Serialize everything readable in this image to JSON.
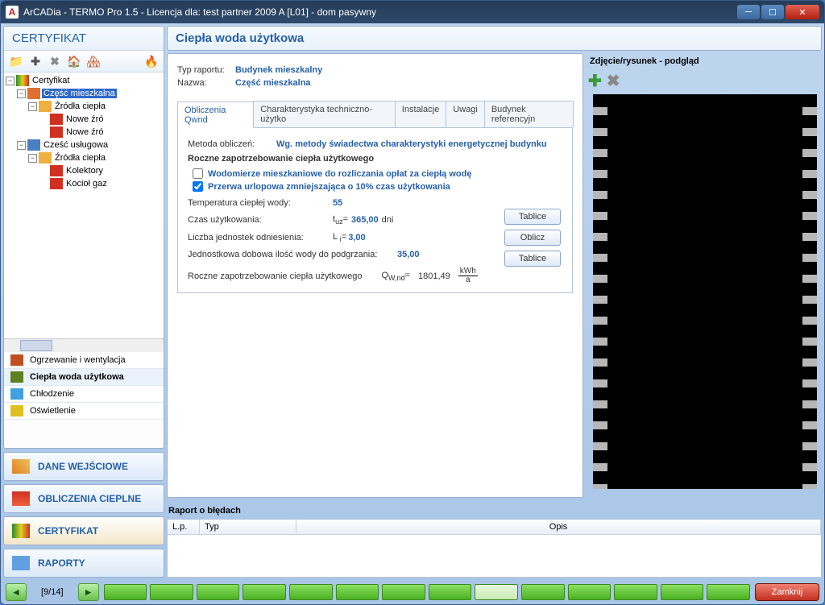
{
  "window": {
    "title": "ArCADia - TERMO Pro 1.5 - Licencja dla: test partner 2009 A [L01] - dom pasywny"
  },
  "left_panel": {
    "title": "CERTYFIKAT",
    "tree": {
      "root": "Certyfikat",
      "n1": "Część mieszkalna",
      "n1a": "Źródła ciepła",
      "n1a1": "Nowe źró",
      "n1a2": "Nowe źró",
      "n2": "Cześć usługowa",
      "n2a": "Źródła ciepła",
      "n2a1": "Kolektory",
      "n2a2": "Kocioł gaz"
    },
    "nav_items": {
      "i1": "Ogrzewanie i wentylacja",
      "i2": "Ciepła woda użytkowa",
      "i3": "Chłodzenie",
      "i4": "Oświetlenie"
    },
    "nav_buttons": {
      "b1": "DANE WEJŚCIOWE",
      "b2": "OBLICZENIA CIEPLNE",
      "b3": "CERTYFIKAT",
      "b4": "RAPORTY"
    }
  },
  "main": {
    "title": "Ciepła woda użytkowa",
    "typ_raportu_label": "Typ raportu:",
    "typ_raportu_value": "Budynek mieszkalny",
    "nazwa_label": "Nazwa:",
    "nazwa_value": "Część mieszkalna",
    "tabs": {
      "t1": "Obliczenia Qwnd",
      "t2": "Charakterystyka techniczno-użytko",
      "t3": "Instalacje",
      "t4": "Uwagi",
      "t5": "Budynek referencyjn"
    },
    "metoda_label": "Metoda obliczeń:",
    "metoda_value": "Wg. metody świadectwa charakterystyki energetycznej budynku",
    "section": "Roczne zapotrzebowanie ciepła użytkowego",
    "chk1": "Wodomierze mieszkaniowe do rozliczania opłat za ciepłą wodę",
    "chk2": "Przerwa urlopowa zmniejszająca o 10% czas użytkowania",
    "temp_label": "Temperatura ciepłej wody:",
    "temp_value": "55",
    "czas_label": "Czas użytkowania:",
    "czas_sym": "t",
    "czas_sub": "uz",
    "czas_value": "365,00",
    "czas_unit": "dni",
    "liczba_label": "Liczba jednostek odniesienia:",
    "liczba_sym": "L",
    "liczba_sub": "i",
    "liczba_value": "3,00",
    "jedn_label": "Jednostkowa dobowa ilość wody do podgrzania:",
    "jedn_value": "35,00",
    "roczne_label": "Roczne zapotrzebowanie ciepła użytkowego",
    "roczne_sym": "Q",
    "roczne_sub": "W,nd",
    "roczne_value": "1801,49",
    "roczne_unit_t": "kWh",
    "roczne_unit_b": "a",
    "btn_tablice": "Tablice",
    "btn_oblicz": "Oblicz"
  },
  "preview": {
    "title": "Zdjęcie/rysunek - podgląd"
  },
  "errors": {
    "title": "Raport o błędach",
    "col1": "L.p.",
    "col2": "Typ",
    "col3": "Opis"
  },
  "footer": {
    "page": "[9/14]",
    "close": "Zamknij"
  }
}
